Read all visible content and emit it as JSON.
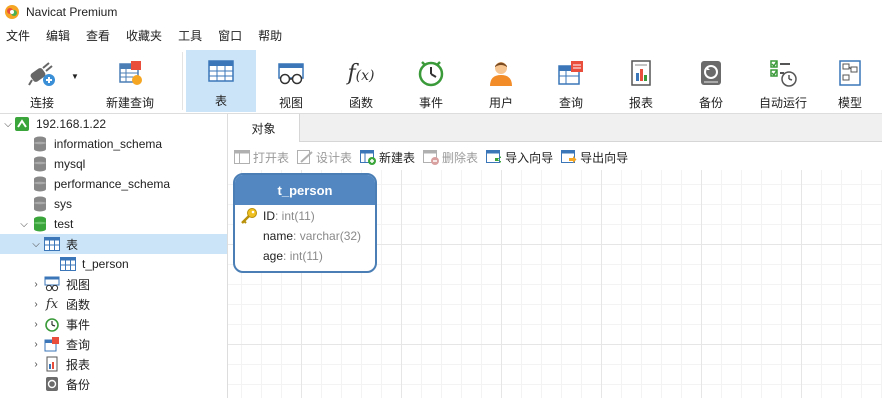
{
  "window": {
    "title": "Navicat Premium"
  },
  "menu": [
    "文件",
    "编辑",
    "查看",
    "收藏夹",
    "工具",
    "窗口",
    "帮助"
  ],
  "toolbar": {
    "connect": "连接",
    "new_query": "新建查询",
    "buttons": [
      "表",
      "视图",
      "函数",
      "事件",
      "用户",
      "查询",
      "报表",
      "备份",
      "自动运行",
      "模型"
    ],
    "active": "表"
  },
  "tree": {
    "connection": "192.168.1.22",
    "databases": [
      "information_schema",
      "mysql",
      "performance_schema",
      "sys",
      "test"
    ],
    "test_children": {
      "tables": "表",
      "table_item": "t_person"
    },
    "groups": [
      "视图",
      "函数",
      "事件",
      "查询",
      "报表",
      "备份"
    ]
  },
  "tab": {
    "label": "对象"
  },
  "object_toolbar": {
    "open": "打开表",
    "design": "设计表",
    "new": "新建表",
    "delete": "删除表",
    "import": "导入向导",
    "export": "导出向导"
  },
  "entity": {
    "name": "t_person",
    "fields": [
      {
        "name": "ID",
        "type": "int(11)"
      },
      {
        "name": "name",
        "type": "varchar(32)"
      },
      {
        "name": "age",
        "type": "int(11)"
      }
    ]
  },
  "colors": {
    "accent": "#5287c2",
    "selection": "#cce4f7",
    "db_green": "#3aa53a"
  }
}
